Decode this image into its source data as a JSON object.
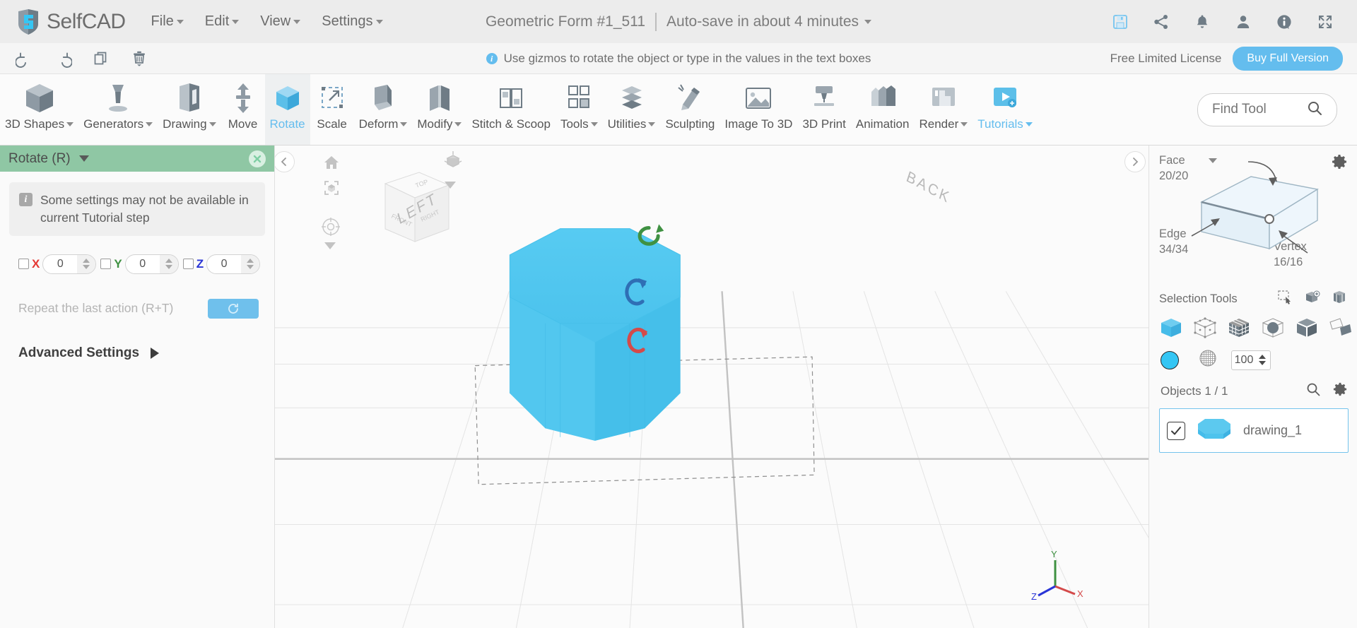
{
  "app": {
    "name": "SelfCAD",
    "logo_icon": "selfcad-logo-icon"
  },
  "menubar": {
    "items": [
      {
        "label": "File",
        "has_caret": true
      },
      {
        "label": "Edit",
        "has_caret": true
      },
      {
        "label": "View",
        "has_caret": true
      },
      {
        "label": "Settings",
        "has_caret": true
      }
    ],
    "document_title": "Geometric Form #1_511",
    "autosave_text": "Auto-save in about 4 minutes",
    "icons": [
      {
        "name": "save-icon",
        "title": "Save"
      },
      {
        "name": "share-icon",
        "title": "Share"
      },
      {
        "name": "notifications-bell-icon",
        "title": "Notifications"
      },
      {
        "name": "user-account-icon",
        "title": "Account"
      },
      {
        "name": "info-icon",
        "title": "Info"
      },
      {
        "name": "fullscreen-icon",
        "title": "Fullscreen"
      }
    ]
  },
  "actionbar": {
    "icons": [
      {
        "name": "undo-icon",
        "title": "Undo"
      },
      {
        "name": "redo-icon",
        "title": "Redo"
      },
      {
        "name": "duplicate-icon",
        "title": "Copy"
      },
      {
        "name": "delete-trash-icon",
        "title": "Delete"
      }
    ],
    "hint": "Use gizmos to rotate the object or type in the values in the text boxes",
    "license_text": "Free Limited License",
    "buy_label": "Buy Full Version"
  },
  "toolbar": {
    "tools": [
      {
        "label": "3D Shapes",
        "icon": "cube-icon",
        "caret": true,
        "active": false
      },
      {
        "label": "Generators",
        "icon": "lathe-icon",
        "caret": true,
        "active": false
      },
      {
        "label": "Drawing",
        "icon": "drawing-icon",
        "caret": true,
        "active": false
      },
      {
        "label": "Move",
        "icon": "move-arrows-icon",
        "caret": false,
        "active": false
      },
      {
        "label": "Rotate",
        "icon": "rotate-cube-icon",
        "caret": false,
        "active": true
      },
      {
        "label": "Scale",
        "icon": "scale-icon",
        "caret": false,
        "active": false
      },
      {
        "label": "Deform",
        "icon": "deform-icon",
        "caret": true,
        "active": false
      },
      {
        "label": "Modify",
        "icon": "modify-icon",
        "caret": true,
        "active": false
      },
      {
        "label": "Stitch & Scoop",
        "icon": "stitch-scoop-icon",
        "caret": false,
        "active": false
      },
      {
        "label": "Tools",
        "icon": "tools-icon",
        "caret": true,
        "active": false
      },
      {
        "label": "Utilities",
        "icon": "utilities-icon",
        "caret": true,
        "active": false
      },
      {
        "label": "Sculpting",
        "icon": "sculpting-icon",
        "caret": false,
        "active": false
      },
      {
        "label": "Image To 3D",
        "icon": "image-to-3d-icon",
        "caret": false,
        "active": false
      },
      {
        "label": "3D Print",
        "icon": "3d-print-icon",
        "caret": false,
        "active": false
      },
      {
        "label": "Animation",
        "icon": "animation-icon",
        "caret": false,
        "active": false
      },
      {
        "label": "Render",
        "icon": "render-icon",
        "caret": true,
        "active": false
      },
      {
        "label": "Tutorials",
        "icon": "tutorials-icon",
        "caret": true,
        "active": false,
        "blue": true
      }
    ],
    "find_tool_placeholder": "Find Tool",
    "find_tool_value": "",
    "search_icon": "search-icon"
  },
  "left_panel": {
    "title": "Rotate (R)",
    "close_icon": "close-icon",
    "notice": "Some settings may not be available in current Tutorial step",
    "axes": [
      {
        "label": "X",
        "value": "0",
        "checked": false,
        "color": "#e53935"
      },
      {
        "label": "Y",
        "value": "0",
        "checked": false,
        "color": "#3f9142"
      },
      {
        "label": "Z",
        "value": "0",
        "checked": false,
        "color": "#2a35d6"
      }
    ],
    "repeat_label": "Repeat the last action (R+T)",
    "repeat_icon": "refresh-icon",
    "advanced_label": "Advanced Settings"
  },
  "right_panel": {
    "gear_icon": "gear-icon",
    "selection": {
      "face_label": "Face",
      "face_count": "20/20",
      "edge_label": "Edge",
      "edge_count": "34/34",
      "vertex_label": "Vertex",
      "vertex_count": "16/16"
    },
    "selection_tools_label": "Selection Tools",
    "selection_tool_icons": [
      {
        "name": "rectangle-select-icon"
      },
      {
        "name": "add-selection-icon"
      },
      {
        "name": "box-selection-icon"
      }
    ],
    "mode_icons": [
      {
        "name": "object-mode-icon",
        "active": true
      },
      {
        "name": "vertex-mode-icon",
        "active": false
      },
      {
        "name": "face-mode-icon",
        "active": false
      },
      {
        "name": "sphere-in-cube-icon",
        "active": false
      },
      {
        "name": "edge-mode-icon",
        "active": false
      },
      {
        "name": "polygon-mode-icon",
        "active": false
      }
    ],
    "material": {
      "color": "#35c6f4",
      "color_swatch_name": "color-swatch",
      "texture_icon": "texture-sphere-icon",
      "opacity_value": "100"
    },
    "objects_label": "Objects 1 / 1",
    "objects_search_icon": "search-icon",
    "objects_gear_icon": "gear-icon",
    "objects": [
      {
        "name": "drawing_1",
        "checked": true,
        "thumbnail": "cylinder-thumbnail"
      }
    ]
  },
  "viewport": {
    "collapse_left_icon": "chevron-left-icon",
    "collapse_right_icon": "chevron-right-icon",
    "tools": [
      {
        "name": "home-view-icon"
      },
      {
        "name": "zoom-to-fit-icon"
      },
      {
        "name": "orbit-navigation-icon"
      },
      {
        "name": "view-cube-gizmo-icon"
      }
    ],
    "view_cube_faces": [
      "TOP",
      "FRONT",
      "RIGHT"
    ],
    "grid_labels": [
      "LEFT",
      "BACK"
    ],
    "axis_indicator": {
      "x": "X",
      "y": "Y",
      "z": "Z"
    },
    "model": {
      "shape": "octagonal-prism",
      "color": "#4ec8ef"
    },
    "gizmos": [
      {
        "name": "rotate-gizmo-green",
        "color": "#3f9142"
      },
      {
        "name": "rotate-gizmo-blue",
        "color": "#2f6fb5"
      },
      {
        "name": "rotate-gizmo-red",
        "color": "#d44a4a"
      }
    ]
  }
}
